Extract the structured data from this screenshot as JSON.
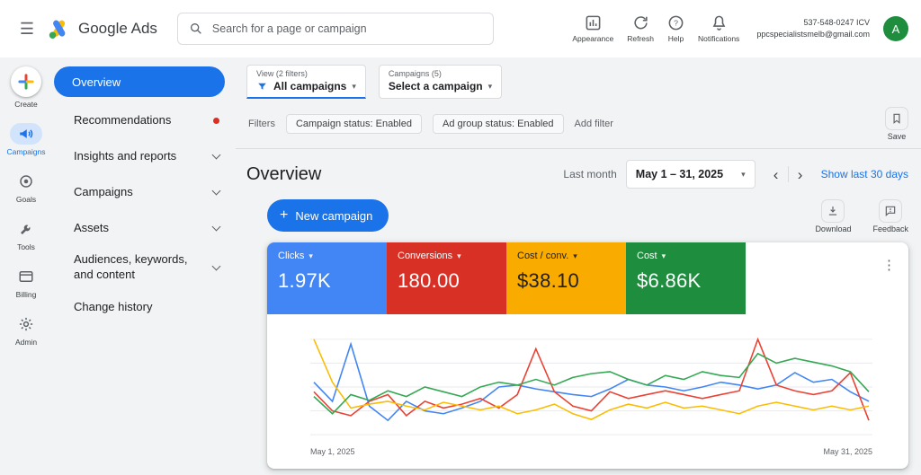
{
  "icons": {
    "hamburger": "☰",
    "dropdown_arrow": "▾",
    "kebab": "⋮",
    "prev": "‹",
    "next": "›",
    "plus": "+"
  },
  "topbar": {
    "app_name": "Google Ads",
    "search_placeholder": "Search for a page or campaign",
    "actions": [
      {
        "label": "Appearance"
      },
      {
        "label": "Refresh"
      },
      {
        "label": "Help"
      },
      {
        "label": "Notifications"
      }
    ],
    "account": {
      "phone": "537-548-0247 ICV",
      "email": "ppcspecialistsmelb@gmail.com",
      "avatar_letter": "A"
    }
  },
  "rail": {
    "items": [
      {
        "label": "Create"
      },
      {
        "label": "Campaigns"
      },
      {
        "label": "Goals"
      },
      {
        "label": "Tools"
      },
      {
        "label": "Billing"
      },
      {
        "label": "Admin"
      }
    ]
  },
  "nav": {
    "items": [
      {
        "label": "Overview"
      },
      {
        "label": "Recommendations"
      },
      {
        "label": "Insights and reports"
      },
      {
        "label": "Campaigns"
      },
      {
        "label": "Assets"
      },
      {
        "label": "Audiences, keywords, and content"
      },
      {
        "label": "Change history"
      }
    ]
  },
  "filters": {
    "view_label": "View (2 filters)",
    "view_value": "All campaigns",
    "campaign_label": "Campaigns (5)",
    "campaign_value": "Select a campaign",
    "filters_label": "Filters",
    "chips": [
      "Campaign status: Enabled",
      "Ad group status: Enabled"
    ],
    "add_filter_label": "Add filter",
    "save_label": "Save"
  },
  "page": {
    "title": "Overview",
    "date_preset_label": "Last month",
    "date_range": "May 1 – 31, 2025",
    "show_last_label": "Show last 30 days",
    "new_campaign_label": "New campaign",
    "download_label": "Download",
    "feedback_label": "Feedback"
  },
  "scorecards": [
    {
      "label": "Clicks",
      "value": "1.97K",
      "color": "#4285f4",
      "text_color": "#ffffff"
    },
    {
      "label": "Conversions",
      "value": "180.00",
      "color": "#d93025",
      "text_color": "#ffffff"
    },
    {
      "label": "Cost / conv.",
      "value": "$38.10",
      "color": "#f9ab00",
      "text_color": "#212121"
    },
    {
      "label": "Cost",
      "value": "$6.86K",
      "color": "#1e8e3e",
      "text_color": "#ffffff"
    }
  ],
  "chart_data": {
    "type": "line",
    "x": [
      1,
      2,
      3,
      4,
      5,
      6,
      7,
      8,
      9,
      10,
      11,
      12,
      13,
      14,
      15,
      16,
      17,
      18,
      19,
      20,
      21,
      22,
      23,
      24,
      25,
      26,
      27,
      28,
      29,
      30,
      31
    ],
    "x_axis_labels": [
      "May 1, 2025",
      "May 31, 2025"
    ],
    "ylim": [
      0,
      100
    ],
    "grid": true,
    "legend": "none",
    "series": [
      {
        "name": "Clicks",
        "color": "#4285f4",
        "values": [
          55,
          35,
          95,
          30,
          15,
          35,
          25,
          22,
          28,
          35,
          50,
          52,
          48,
          45,
          42,
          40,
          48,
          58,
          52,
          50,
          46,
          50,
          55,
          52,
          48,
          52,
          65,
          55,
          58,
          45,
          35
        ]
      },
      {
        "name": "Conversions",
        "color": "#ea4335",
        "values": [
          45,
          25,
          20,
          35,
          42,
          20,
          35,
          28,
          32,
          38,
          28,
          42,
          90,
          45,
          30,
          25,
          45,
          38,
          42,
          46,
          42,
          38,
          42,
          46,
          100,
          52,
          46,
          42,
          46,
          65,
          15
        ]
      },
      {
        "name": "Cost / conv.",
        "color": "#fbbc04",
        "values": [
          100,
          55,
          28,
          32,
          35,
          30,
          26,
          34,
          30,
          26,
          30,
          22,
          26,
          32,
          22,
          16,
          26,
          32,
          28,
          34,
          28,
          30,
          26,
          22,
          30,
          34,
          30,
          26,
          30,
          26,
          30
        ]
      },
      {
        "name": "Cost",
        "color": "#34a853",
        "values": [
          40,
          22,
          42,
          36,
          46,
          40,
          50,
          45,
          40,
          50,
          55,
          52,
          58,
          52,
          60,
          64,
          66,
          58,
          52,
          62,
          58,
          66,
          62,
          60,
          85,
          75,
          80,
          76,
          72,
          66,
          45
        ]
      }
    ]
  }
}
